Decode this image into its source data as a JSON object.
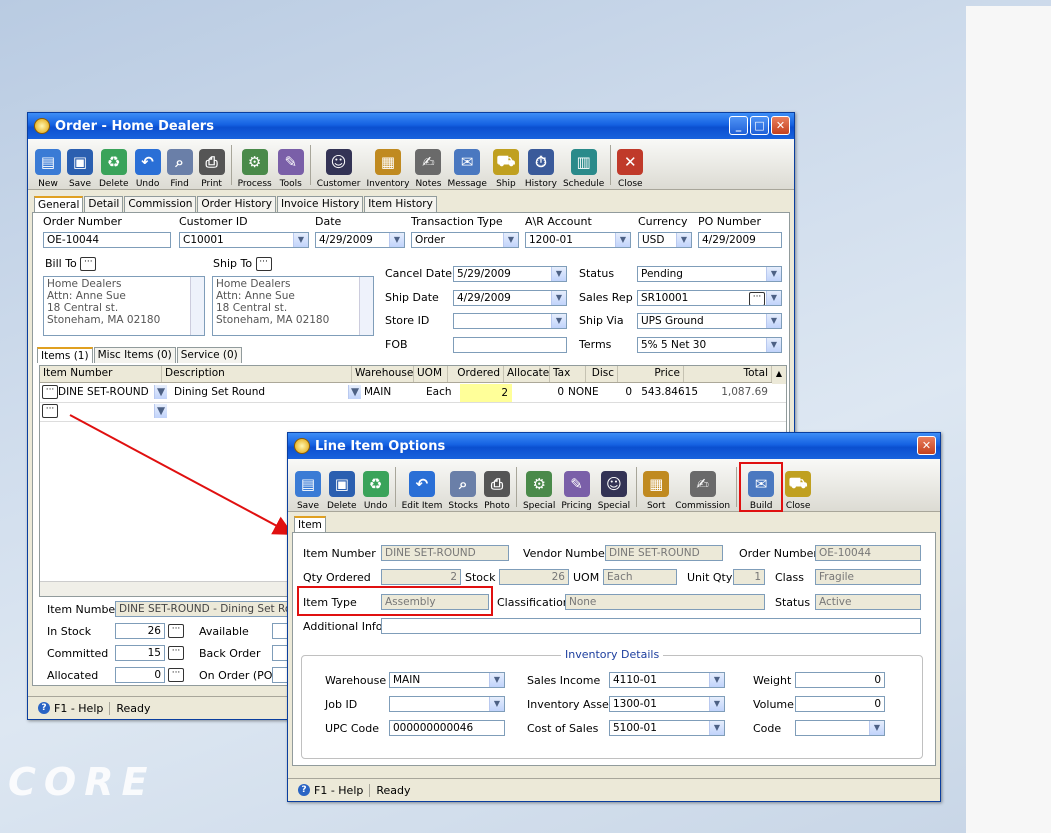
{
  "background_brand": "CORE",
  "order_window": {
    "title": "Order - Home Dealers",
    "toolbar": [
      "New",
      "Save",
      "Delete",
      "Undo",
      "Find",
      "Print",
      "Process",
      "Tools",
      "Customer",
      "Inventory",
      "Notes",
      "Message",
      "Ship",
      "History",
      "Schedule",
      "Close"
    ],
    "tabs": [
      "General",
      "Detail",
      "Commission",
      "Order History",
      "Invoice History",
      "Item History"
    ],
    "labels": {
      "order_number": "Order Number",
      "customer_id": "Customer ID",
      "date": "Date",
      "transaction_type": "Transaction Type",
      "ar_account": "A\\R Account",
      "currency": "Currency",
      "po_number": "PO Number",
      "bill_to": "Bill To",
      "ship_to": "Ship To",
      "cancel_date": "Cancel Date",
      "ship_date": "Ship Date",
      "store_id": "Store ID",
      "fob": "FOB",
      "status": "Status",
      "sales_rep": "Sales Rep",
      "ship_via": "Ship Via",
      "terms": "Terms"
    },
    "values": {
      "order_number": "OE-10044",
      "customer_id": "C10001",
      "date": "4/29/2009",
      "transaction_type": "Order",
      "ar_account": "1200-01",
      "currency": "USD",
      "po_number": "4/29/2009",
      "cancel_date": "5/29/2009",
      "ship_date": "4/29/2009",
      "store_id": "",
      "fob": "",
      "status": "Pending",
      "sales_rep": "SR10001",
      "ship_via": "UPS Ground",
      "terms": "5% 5 Net 30"
    },
    "bill_to_lines": [
      "Home Dealers",
      "Attn: Anne Sue",
      "18 Central st.",
      "Stoneham, MA 02180"
    ],
    "ship_to_lines": [
      "Home Dealers",
      "Attn: Anne Sue",
      "18 Central st.",
      "Stoneham, MA 02180"
    ],
    "item_tabs": [
      "Items (1)",
      "Misc Items (0)",
      "Service (0)"
    ],
    "grid_headers": [
      "Item Number",
      "Description",
      "Warehouse",
      "UOM",
      "Ordered",
      "Allocate",
      "Tax",
      "Disc",
      "Price",
      "Total"
    ],
    "grid_row": {
      "item": "DINE SET-ROUND",
      "description": "Dining Set Round",
      "warehouse": "MAIN",
      "uom": "Each",
      "ordered": "2",
      "allocate": "0",
      "tax": "NONE",
      "disc": "0",
      "price": "543.84615",
      "total": "1,087.69"
    },
    "bottom": {
      "item_number_label": "Item Number",
      "item_number_value": "DINE SET-ROUND - Dining Set Roun",
      "in_stock_label": "In Stock",
      "in_stock": "26",
      "committed_label": "Committed",
      "committed": "15",
      "allocated_label": "Allocated",
      "allocated": "0",
      "available_label": "Available",
      "back_order_label": "Back Order",
      "on_order_label": "On Order (PO)"
    },
    "status": {
      "help": "F1 - Help",
      "state": "Ready"
    }
  },
  "line_item_window": {
    "title": "Line Item Options",
    "toolbar": [
      "Save",
      "Delete",
      "Undo",
      "Edit Item",
      "Stocks",
      "Photo",
      "Special",
      "Pricing",
      "Special",
      "Sort",
      "Commission",
      "Build",
      "Close"
    ],
    "tab": "Item",
    "labels": {
      "item_number": "Item Number",
      "vendor_number": "Vendor Number",
      "order_number": "Order Number",
      "qty_ordered": "Qty Ordered",
      "stock": "Stock",
      "uom": "UOM",
      "unit_qty": "Unit Qty",
      "class": "Class",
      "item_type": "Item Type",
      "classification": "Classification",
      "status": "Status",
      "additional_info": "Additional Info"
    },
    "values": {
      "item_number": "DINE SET-ROUND",
      "vendor_number": "DINE SET-ROUND",
      "order_number": "OE-10044",
      "qty_ordered": "2",
      "stock": "26",
      "uom": "Each",
      "unit_qty": "1",
      "class": "Fragile",
      "item_type": "Assembly",
      "classification": "None",
      "status": "Active",
      "additional_info": ""
    },
    "inventory": {
      "title": "Inventory Details",
      "warehouse_label": "Warehouse",
      "warehouse": "MAIN",
      "job_id_label": "Job ID",
      "job_id": "",
      "upc_label": "UPC Code",
      "upc": "000000000046",
      "sales_income_label": "Sales Income",
      "sales_income": "4110-01",
      "inventory_assets_label": "Inventory Assets",
      "inventory_assets": "1300-01",
      "cost_of_sales_label": "Cost of Sales",
      "cost_of_sales": "5100-01",
      "weight_label": "Weight",
      "weight": "0",
      "volume_label": "Volume",
      "volume": "0",
      "code_label": "Code",
      "code": ""
    },
    "status": {
      "help": "F1 - Help",
      "state": "Ready"
    }
  },
  "colors": {
    "highlight": "#e01010",
    "ordered_cell": "#ffff99",
    "titlebar": "#0b4fd0"
  }
}
